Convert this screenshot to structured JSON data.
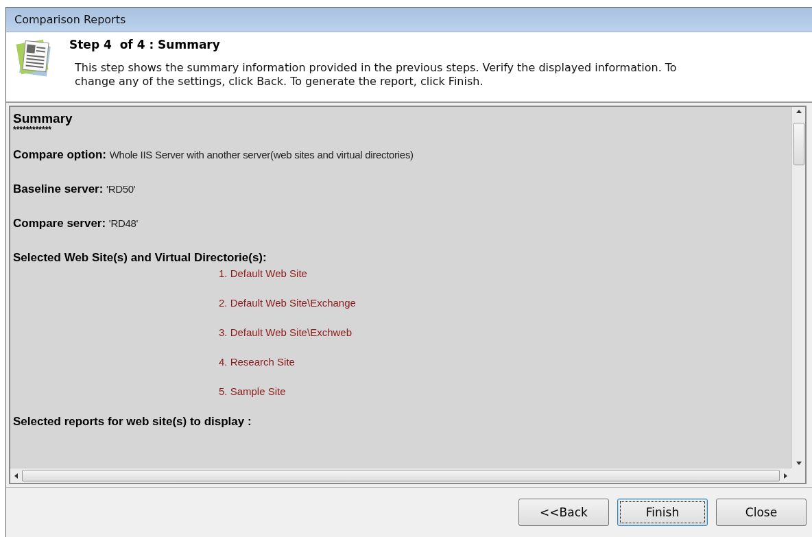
{
  "window": {
    "title": "Comparison Reports"
  },
  "header": {
    "step": "Step 4  of 4 : Summary",
    "description": "This step shows the summary information provided in the previous steps. Verify the displayed information. To change any of the settings, click Back. To generate the report, click Finish."
  },
  "summary": {
    "heading": "Summary",
    "rule": "************",
    "fields": [
      {
        "label": "Compare option:",
        "value": "Whole IIS Server with another server(web sites and virtual directories)"
      },
      {
        "label": "Baseline server:",
        "value": "'RD50'"
      },
      {
        "label": "Compare server:",
        "value": "'RD48'"
      }
    ],
    "sites_heading": "Selected Web Site(s) and Virtual Directorie(s):",
    "sites": [
      "1. Default Web Site",
      "2. Default Web Site\\Exchange",
      "3. Default Web Site\\Exchweb",
      "4. Research Site",
      "5. Sample Site"
    ],
    "reports_heading": "Selected reports for web site(s) to display :"
  },
  "buttons": [
    {
      "label": "<<Back",
      "focused": false
    },
    {
      "label": "Finish",
      "focused": true
    },
    {
      "label": "Close",
      "focused": false
    }
  ]
}
